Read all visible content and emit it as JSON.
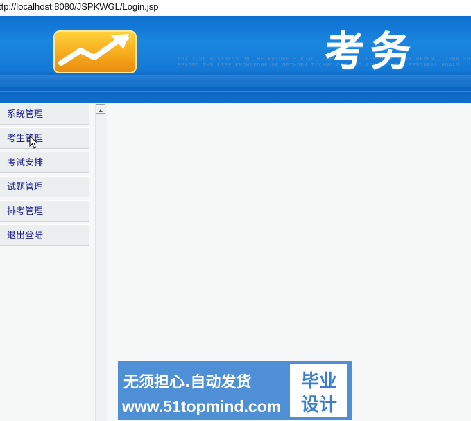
{
  "address_bar": {
    "url": "ttp://localhost:8080/JSPKWGL/Login.jsp"
  },
  "banner": {
    "title": "考务",
    "tagline_line1": "PUT YOUR BUSINESS ON THE FUTURE'S ROAD, THROUGH THE PERSONAL DEVELOPMENT, YOUR SUCCESS",
    "tagline_line2": "BEYOND THE LIFE KNOWLEDGE OF NETWORK TECHNOLOGY AND ACHIEVE THE PERSONAL GOALS"
  },
  "sidebar": {
    "items": [
      {
        "label": "系统管理"
      },
      {
        "label": "考生管理"
      },
      {
        "label": "考试安排"
      },
      {
        "label": "试题管理"
      },
      {
        "label": "排考管理"
      },
      {
        "label": "退出登陆"
      }
    ]
  },
  "ad": {
    "slogan": "无须担心.自动发货",
    "url": "www.51topmind.com",
    "box_line1": "毕业",
    "box_line2": "设计"
  },
  "colors": {
    "banner_blue": "#1479d6",
    "menu_text": "#1a1a8c",
    "ad_blue": "#4e8fd6"
  }
}
